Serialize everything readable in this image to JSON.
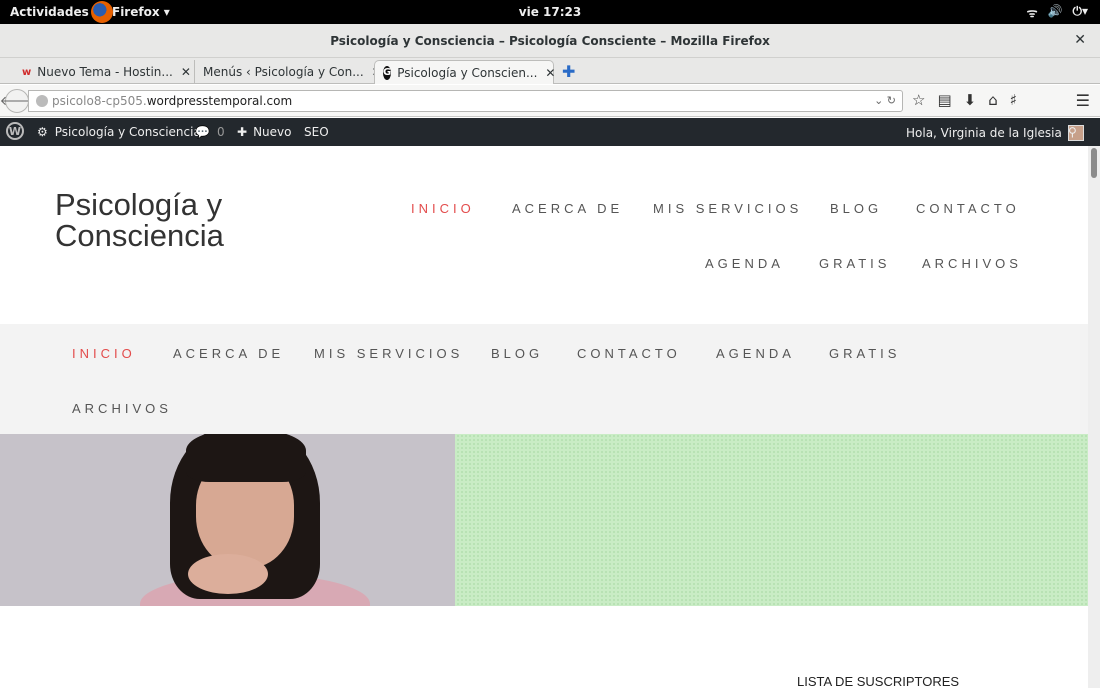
{
  "system": {
    "activities": "Actividades",
    "app_name": "Firefox ▾",
    "clock": "vie 17:23",
    "tray": [
      "wifi-icon",
      "volume-icon",
      "power-icon"
    ]
  },
  "browser": {
    "window_title": "Psicología y Consciencia – Psicología Consciente – Mozilla Firefox",
    "tabs": [
      {
        "label": "Nuevo Tema - Hostin...",
        "favicon": "w",
        "active": false
      },
      {
        "label": "Menús ‹ Psicología y Con...",
        "favicon": "",
        "active": false
      },
      {
        "label": "Psicología y Conscien...",
        "favicon": "G",
        "active": true
      }
    ],
    "url_prefix": "psicolo8-cp505.",
    "url_domain": "wordpresstemporal.com"
  },
  "admin_bar": {
    "site_name": "Psicología y Consciencia",
    "comments_count": "0",
    "new_label": "Nuevo",
    "seo_label": "SEO",
    "greeting": "Hola, Virginia de la Iglesia"
  },
  "site": {
    "title": "Psicología y Consciencia",
    "primary_nav": [
      "INICIO",
      "ACERCA DE",
      "MIS SERVICIOS",
      "BLOG",
      "CONTACTO",
      "AGENDA",
      "GRATIS",
      "ARCHIVOS"
    ],
    "secondary_nav": [
      "INICIO",
      "ACERCA DE",
      "MIS SERVICIOS",
      "BLOG",
      "CONTACTO",
      "AGENDA",
      "GRATIS",
      "ARCHIVOS"
    ],
    "active_nav": "INICIO",
    "sidebar_title": "LISTA DE SUSCRIPTORES"
  },
  "colors": {
    "accent": "#e34c4c",
    "admin_bar": "#23282d",
    "hero_green": "#c9ecc5"
  }
}
